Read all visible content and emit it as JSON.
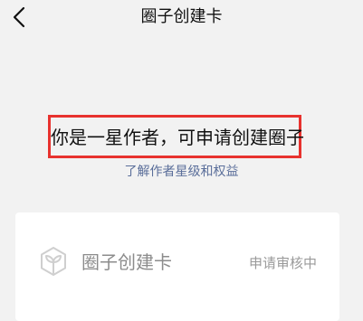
{
  "header": {
    "title": "圈子创建卡",
    "back_icon": "chevron-left-icon"
  },
  "notice": {
    "message": "你是一星作者，可申请创建圈子",
    "highlight_color": "#e8322e"
  },
  "link": {
    "label": "了解作者星级和权益",
    "color": "#5a6e9a"
  },
  "card": {
    "icon": "hexagon-leaf-icon",
    "title": "圈子创建卡",
    "status": "申请审核中"
  }
}
